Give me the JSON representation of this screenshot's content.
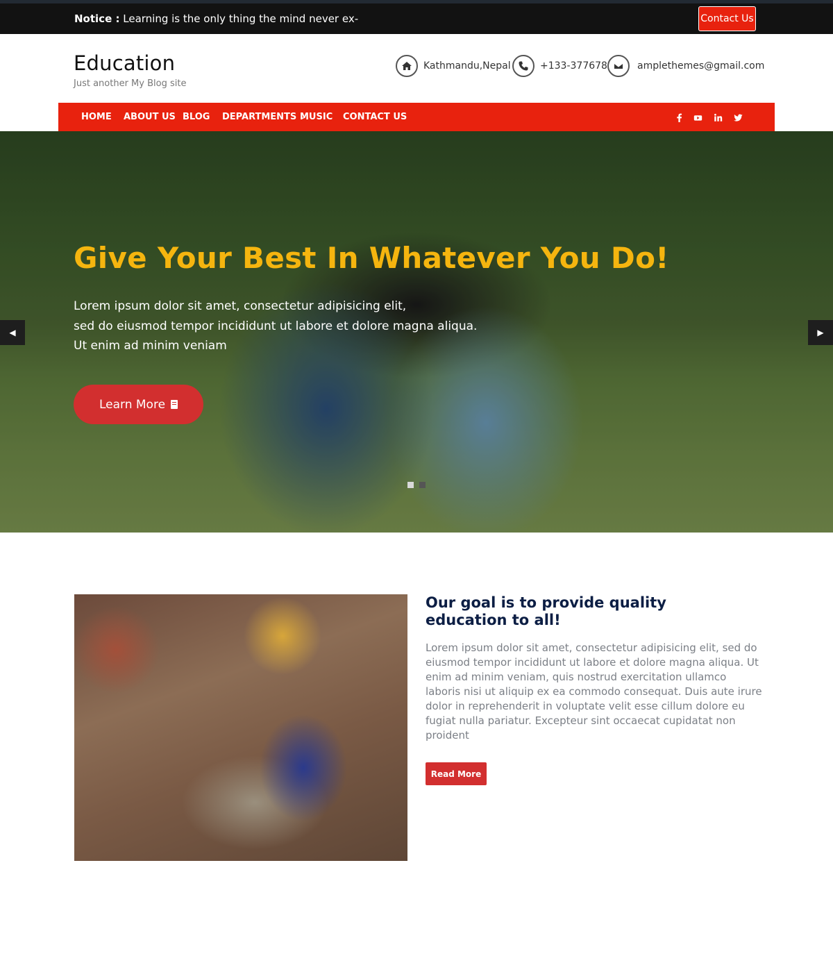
{
  "topbar": {
    "notice_label": "Notice :",
    "notice_text": "Learning is the only thing the mind never ex-",
    "contact_button": "Contact Us"
  },
  "header": {
    "site_title": "Education",
    "tagline": "Just another My Blog site",
    "location": "Kathmandu,Nepal",
    "phone": "+133-377678",
    "email": "amplethemes@gmail.com"
  },
  "nav": {
    "items": [
      "HOME",
      "ABOUT US",
      "BLOG",
      "DEPARTMENTS",
      "MUSIC",
      "CONTACT US"
    ],
    "social": [
      "facebook-icon",
      "youtube-icon",
      "linkedin-icon",
      "twitter-icon"
    ],
    "accent_color": "#e8220e"
  },
  "hero": {
    "title": "Give Your Best In Whatever You Do!",
    "lines": [
      "Lorem ipsum dolor sit amet, consectetur adipisicing elit,",
      "sed do eiusmod tempor incididunt ut labore et dolore magna aliqua.",
      "Ut enim ad minim veniam"
    ],
    "button": "Learn More",
    "title_color": "#f5b50f",
    "active_slide": 1,
    "slide_count": 2
  },
  "about": {
    "title": "Our goal is to provide quality education to all!",
    "body": "Lorem ipsum dolor sit amet, consectetur adipisicing elit, sed do eiusmod tempor incididunt ut labore et dolore magna aliqua. Ut enim ad minim veniam, quis nostrud exercitation ullamco laboris nisi ut aliquip ex ea commodo consequat. Duis aute irure dolor in reprehenderit in voluptate velit esse cillum dolore eu fugiat nulla pariatur. Excepteur sint occaecat cupidatat non proident",
    "button": "Read More"
  }
}
